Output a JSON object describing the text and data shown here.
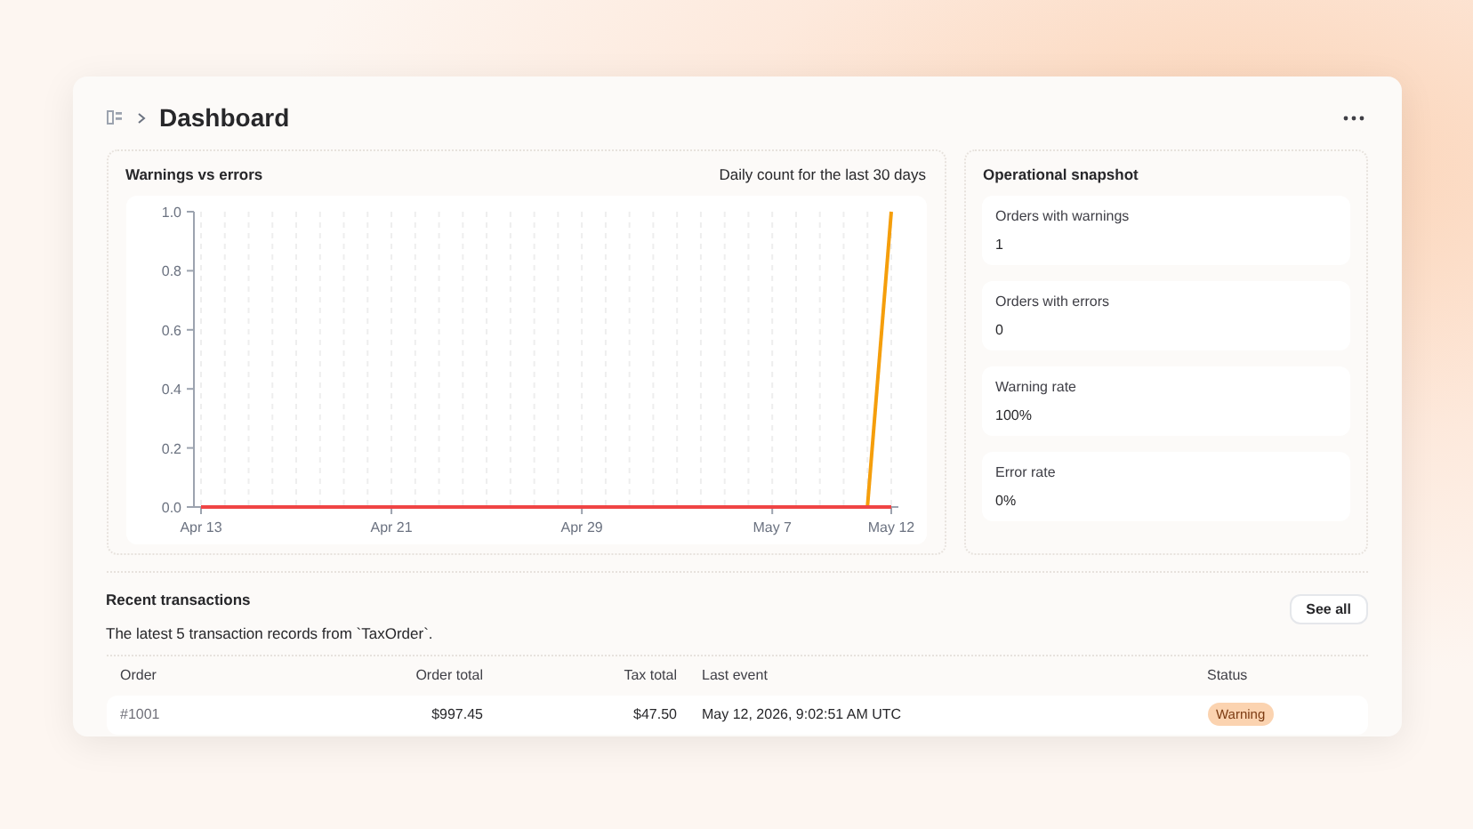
{
  "breadcrumb": {
    "title": "Dashboard"
  },
  "chart_panel": {
    "title": "Warnings vs errors",
    "subtitle": "Daily count for the last 30 days",
    "chart_data": {
      "type": "line",
      "grid": true,
      "categories": [
        "Apr 13",
        null,
        null,
        null,
        null,
        null,
        null,
        null,
        "Apr 21",
        null,
        null,
        null,
        null,
        null,
        null,
        null,
        "Apr 29",
        null,
        null,
        null,
        null,
        null,
        null,
        null,
        "May 7",
        null,
        null,
        null,
        null,
        "May 12"
      ],
      "series": [
        {
          "color": "#f59e0b",
          "values": [
            null,
            null,
            null,
            null,
            null,
            null,
            null,
            null,
            null,
            null,
            null,
            null,
            null,
            null,
            null,
            null,
            null,
            null,
            null,
            null,
            null,
            null,
            null,
            null,
            null,
            null,
            null,
            null,
            0,
            1
          ]
        },
        {
          "color": "#ef4444",
          "values": [
            0,
            0,
            0,
            0,
            0,
            0,
            0,
            0,
            0,
            0,
            0,
            0,
            0,
            0,
            0,
            0,
            0,
            0,
            0,
            0,
            0,
            0,
            0,
            0,
            0,
            0,
            0,
            0,
            0,
            0
          ]
        }
      ],
      "ylim": [
        0,
        1
      ],
      "yticks": [
        {
          "value": 0,
          "label": "0.0"
        },
        {
          "value": 0.2,
          "label": "0.2"
        },
        {
          "value": 0.4,
          "label": "0.4"
        },
        {
          "value": 0.6,
          "label": "0.6"
        },
        {
          "value": 0.8,
          "label": "0.8"
        },
        {
          "value": 1,
          "label": "1.0"
        }
      ]
    }
  },
  "snapshot": {
    "title": "Operational snapshot",
    "stats": [
      {
        "label": "Orders with warnings",
        "value": "1"
      },
      {
        "label": "Orders with errors",
        "value": "0"
      },
      {
        "label": "Warning rate",
        "value": "100%"
      },
      {
        "label": "Error rate",
        "value": "0%"
      }
    ]
  },
  "transactions": {
    "title": "Recent transactions",
    "description": "The latest 5 transaction records from `TaxOrder`.",
    "button": "See all",
    "columns": [
      "Order",
      "Order total",
      "Tax total",
      "Last event",
      "Status"
    ],
    "rows": [
      {
        "order": "#1001",
        "order_total": "$997.45",
        "tax_total": "$47.50",
        "last_event": "May 12, 2026, 9:02:51 AM UTC",
        "status": "Warning",
        "kind": "warning"
      }
    ]
  }
}
